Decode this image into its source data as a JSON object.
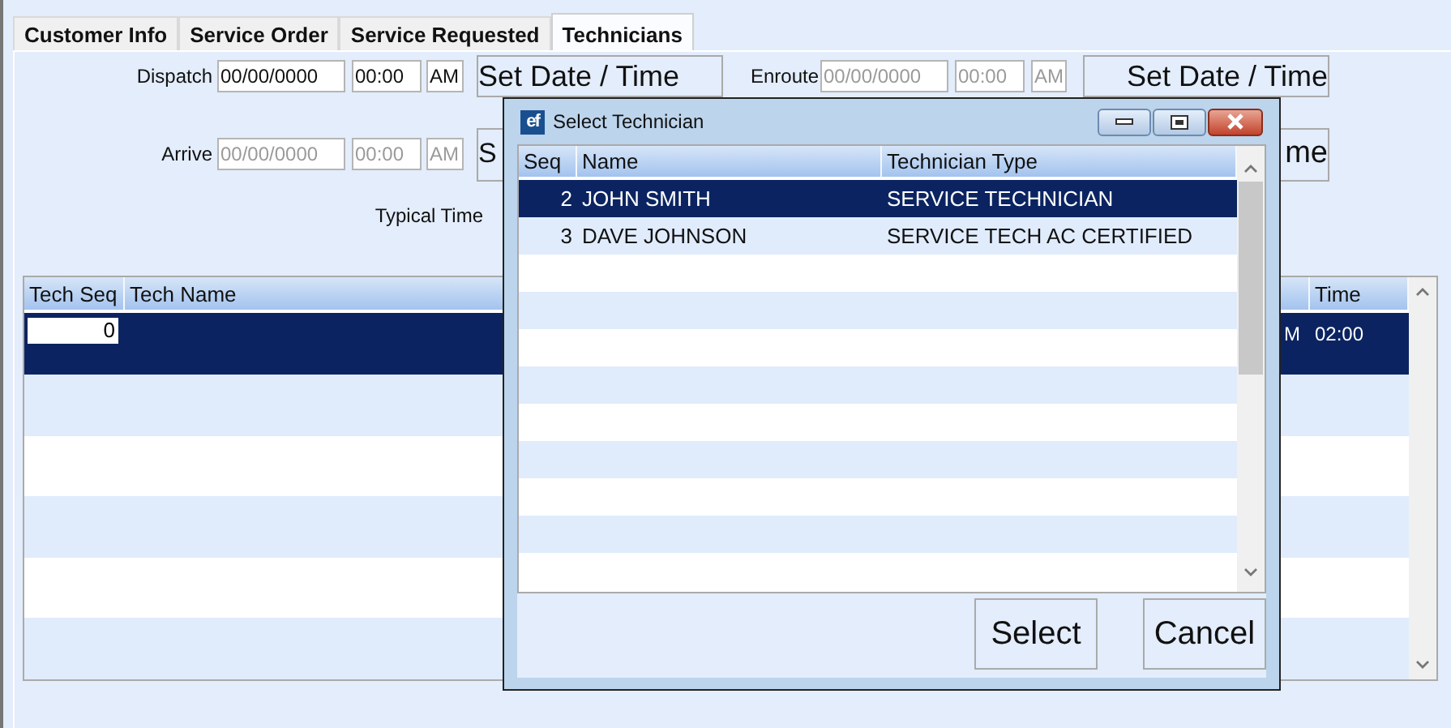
{
  "tabs": [
    {
      "label": "Customer Info",
      "selected": false
    },
    {
      "label": "Service Order",
      "selected": false
    },
    {
      "label": "Service Requested",
      "selected": false
    },
    {
      "label": "Technicians",
      "selected": true
    }
  ],
  "schedule": [
    {
      "label": "Dispatch",
      "date": "00/00/0000",
      "time": "00:00",
      "ampm": "AM",
      "disabled": false,
      "button": "Set Date / Time"
    },
    {
      "label": "Arrive",
      "date": "00/00/0000",
      "time": "00:00",
      "ampm": "AM",
      "disabled": true,
      "button": "S"
    }
  ],
  "enroute": [
    {
      "label": "Enroute",
      "date": "00/00/0000",
      "time": "00:00",
      "ampm": "AM",
      "disabled": true,
      "button": "Set Date / Time"
    },
    {
      "button": "me"
    }
  ],
  "typical_time": {
    "label": "Typical Time"
  },
  "table": {
    "columns": [
      "Tech Seq",
      "Tech Name",
      "Time"
    ],
    "rows": [
      {
        "selected": true,
        "tech_seq": "0",
        "column_3": "M",
        "time": "02:00"
      },
      {
        "selected": false
      },
      {
        "selected": false
      },
      {
        "selected": false
      },
      {
        "selected": false
      },
      {
        "selected": false
      }
    ]
  },
  "dialog": {
    "icon_label": "ef",
    "title": "Select Technician",
    "columns": [
      "Seq",
      "Name",
      "Technician Type"
    ],
    "rows": [
      {
        "seq": "2",
        "name": "JOHN SMITH",
        "type": "SERVICE TECHNICIAN",
        "selected": true
      },
      {
        "seq": "3",
        "name": "DAVE JOHNSON",
        "type": "SERVICE TECH AC CERTIFIED",
        "selected": false
      }
    ],
    "buttons": [
      "Select",
      "Cancel"
    ]
  }
}
